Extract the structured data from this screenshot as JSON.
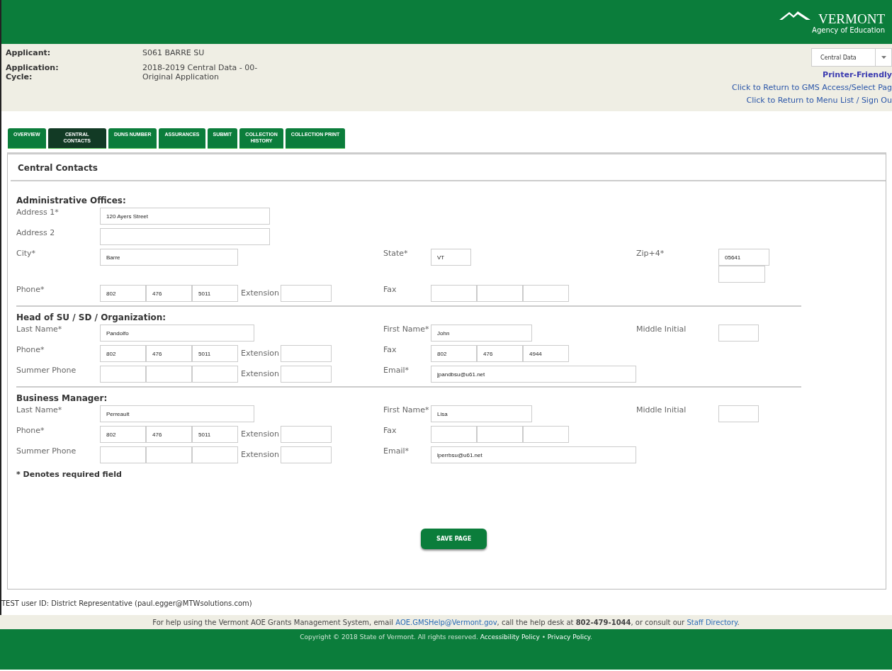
{
  "header": {
    "logo_title": "VERMONT",
    "logo_subtitle": "Agency of Education"
  },
  "applicant_info": [
    {
      "label": "Applicant:",
      "value": "S061 BARRE SU"
    },
    {
      "label": "Application: Cycle:",
      "value": "2018-2019 Central Data - 00- Original Application"
    }
  ],
  "program_select": {
    "value": "Central Data"
  },
  "header_links": [
    {
      "text": "Printer-Friendly",
      "kind": "bold"
    },
    {
      "text": "Click to Return to GMS Access/Select Pag",
      "kind": "plain"
    },
    {
      "text": "Click to Return to Menu List / Sign Ou",
      "kind": "plain"
    }
  ],
  "tabs": [
    {
      "lines": [
        "OVERVIEW"
      ],
      "selected": false
    },
    {
      "lines": [
        "CENTRAL",
        "CONTACTS"
      ],
      "selected": true
    },
    {
      "lines": [
        "DUNS NUMBER"
      ],
      "selected": false
    },
    {
      "lines": [
        "ASSURANCES"
      ],
      "selected": false
    },
    {
      "lines": [
        "SUBMIT"
      ],
      "selected": false
    },
    {
      "lines": [
        "COLLECTION",
        "HISTORY"
      ],
      "selected": false
    },
    {
      "lines": [
        "COLLECTION PRINT"
      ],
      "selected": false
    }
  ],
  "page_title": "Central Contacts",
  "sections": [
    {
      "title": "Administrative Offices:",
      "rows": [
        [
          {
            "label": "Address 1*",
            "kind": "address",
            "value": "120 Ayers Street"
          }
        ],
        [
          {
            "label": "Address 2",
            "kind": "address"
          }
        ],
        [
          {
            "label": "City*",
            "kind": "city",
            "value": "Barre"
          },
          {
            "label": "State*",
            "kind": "state",
            "value": "VT"
          },
          {
            "label": "Zip+4*",
            "kind": "zip",
            "value": "05641"
          }
        ],
        [
          {
            "label": "Phone*",
            "kind": "phone",
            "parts": [
              "802",
              "476",
              "5011"
            ],
            "extension": {
              "label": "Extension"
            }
          },
          {
            "label": "Fax",
            "kind": "phone"
          }
        ]
      ]
    },
    {
      "title": "Head of SU / SD / Organization:",
      "rows": [
        [
          {
            "label": "Last Name*",
            "kind": "last-name",
            "value": "Pandolfo"
          },
          {
            "label": "First Name*",
            "kind": "first-name",
            "value": "John"
          },
          {
            "label": "Middle Initial",
            "kind": "initial"
          }
        ],
        [
          {
            "label": "Phone*",
            "kind": "phone",
            "parts": [
              "802",
              "476",
              "5011"
            ],
            "extension": {
              "label": "Extension"
            }
          },
          {
            "label": "Fax",
            "kind": "phone",
            "parts": [
              "802",
              "476",
              "4944"
            ]
          }
        ],
        [
          {
            "label": "Summer Phone",
            "kind": "phone",
            "extension": {
              "label": "Extension"
            }
          },
          {
            "label": "Email*",
            "kind": "email",
            "value": "jpandbsu@u61.net"
          }
        ]
      ]
    },
    {
      "title": "Business Manager:",
      "rows": [
        [
          {
            "label": "Last Name*",
            "kind": "last-name",
            "value": "Perreault"
          },
          {
            "label": "First Name*",
            "kind": "first-name",
            "value": "Lisa"
          },
          {
            "label": "Middle Initial",
            "kind": "initial"
          }
        ],
        [
          {
            "label": "Phone*",
            "kind": "phone",
            "parts": [
              "802",
              "476",
              "5011"
            ],
            "extension": {
              "label": "Extension"
            }
          },
          {
            "label": "Fax",
            "kind": "phone"
          }
        ],
        [
          {
            "label": "Summer Phone",
            "kind": "phone",
            "extension": {
              "label": "Extension"
            }
          },
          {
            "label": "Email*",
            "kind": "email",
            "value": "lperrbsu@u61.net"
          }
        ]
      ]
    }
  ],
  "required_note": "* Denotes required field",
  "save_button": "SAVE PAGE",
  "user_id": "TEST user ID: District Representative (paul.egger@MTWsolutions.com)",
  "help": [
    {
      "kind": "text",
      "text": "For help using the Vermont AOE Grants Management System, email "
    },
    {
      "kind": "link",
      "text": "AOE.GMSHelp@Vermont.gov"
    },
    {
      "kind": "text",
      "text": ", call the help desk at "
    },
    {
      "kind": "bold",
      "text": "802-479-1044"
    },
    {
      "kind": "text",
      "text": ", or consult our "
    },
    {
      "kind": "link",
      "text": "Staff Directory"
    },
    {
      "kind": "text",
      "text": "."
    }
  ],
  "footer": [
    {
      "kind": "text",
      "text": "Copyright © 2018 State of Vermont. All rights reserved. "
    },
    {
      "kind": "link",
      "text": "Accessibility Policy"
    },
    {
      "kind": "text",
      "text": " • "
    },
    {
      "kind": "link",
      "text": "Privacy Policy"
    },
    {
      "kind": "text",
      "text": "."
    }
  ]
}
